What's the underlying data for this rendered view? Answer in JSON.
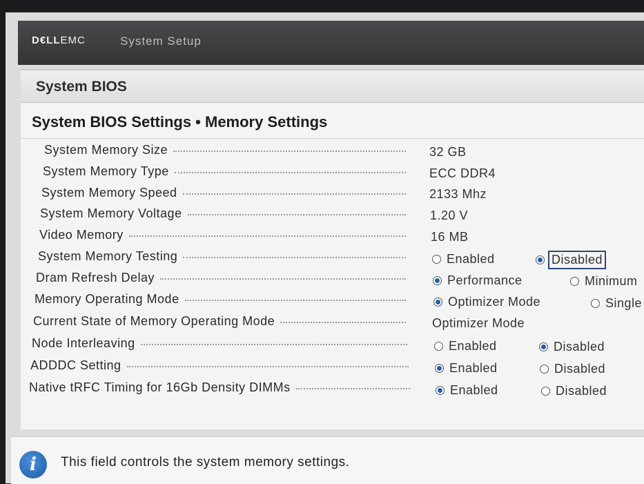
{
  "header": {
    "brand_dell": "D€LL",
    "brand_emc": "EMC",
    "app_title": "System Setup"
  },
  "page": {
    "section_title": "System BIOS",
    "breadcrumb": "System BIOS Settings • Memory Settings"
  },
  "settings": [
    {
      "label": "System Memory Size",
      "value": "32 GB"
    },
    {
      "label": "System Memory Type",
      "value": "ECC DDR4"
    },
    {
      "label": "System Memory Speed",
      "value": "2133 Mhz"
    },
    {
      "label": "System Memory Voltage",
      "value": "1.20 V"
    },
    {
      "label": "Video Memory",
      "value": "16 MB"
    },
    {
      "label": "System Memory Testing",
      "options": [
        "Enabled",
        "Disabled"
      ],
      "selected": "Disabled"
    },
    {
      "label": "Dram Refresh Delay",
      "options": [
        "Performance",
        "Minimum"
      ],
      "selected": "Performance"
    },
    {
      "label": "Memory Operating Mode",
      "options": [
        "Optimizer Mode",
        "Single"
      ],
      "selected": "Optimizer Mode"
    },
    {
      "label": "Current State of Memory Operating Mode",
      "value": "Optimizer Mode"
    },
    {
      "label": "Node Interleaving",
      "options": [
        "Enabled",
        "Disabled"
      ],
      "selected": "Disabled"
    },
    {
      "label": "ADDDC Setting",
      "options": [
        "Enabled",
        "Disabled"
      ],
      "selected": "Enabled"
    },
    {
      "label": "Native tRFC Timing for 16Gb Density DIMMs",
      "options": [
        "Enabled",
        "Disabled"
      ],
      "selected": "Enabled"
    }
  ],
  "help": {
    "icon": "info-icon",
    "text": "This field controls the system memory settings."
  },
  "colors": {
    "radio_selected": "#1e5fb0",
    "header_bg": "#3c3c3e"
  }
}
